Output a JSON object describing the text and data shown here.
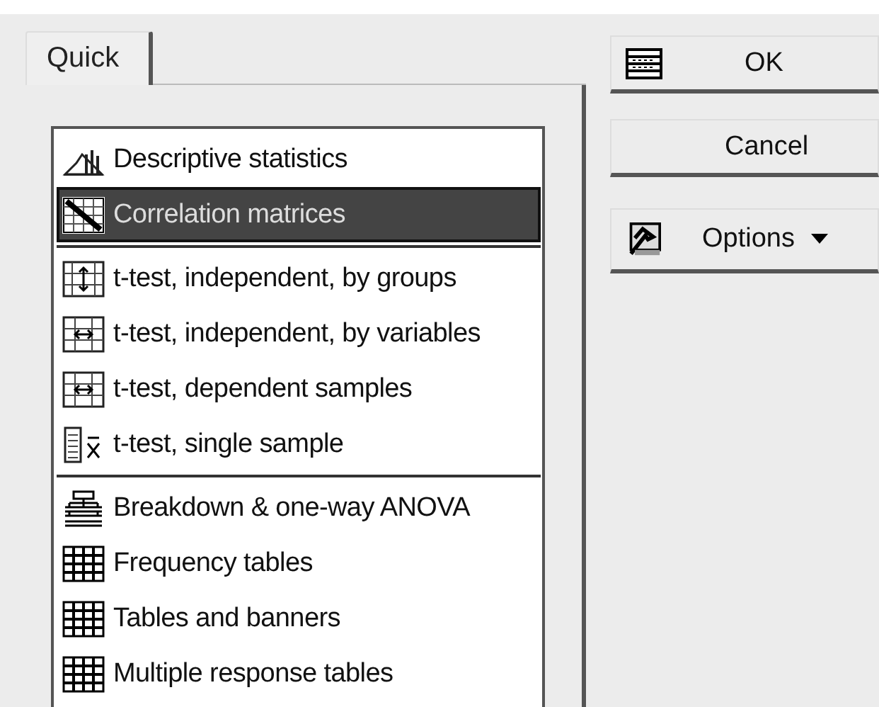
{
  "tabs": [
    {
      "label": "Quick",
      "selected": true
    }
  ],
  "list": {
    "groups": [
      {
        "items": [
          {
            "label": "Descriptive statistics",
            "kind": "histogram",
            "selected": false
          },
          {
            "label": "Correlation matrices",
            "kind": "matrix",
            "selected": true
          }
        ]
      },
      {
        "items": [
          {
            "label": "t-test, independent, by groups",
            "kind": "groups",
            "selected": false
          },
          {
            "label": "t-test, independent, by variables",
            "kind": "variables",
            "selected": false
          },
          {
            "label": "t-test, dependent samples",
            "kind": "variables",
            "selected": false
          },
          {
            "label": "t-test, single sample",
            "kind": "single",
            "selected": false
          }
        ]
      },
      {
        "items": [
          {
            "label": "Breakdown & one-way ANOVA",
            "kind": "tree",
            "selected": false
          },
          {
            "label": "Frequency tables",
            "kind": "grid",
            "selected": false
          },
          {
            "label": "Tables and banners",
            "kind": "grid",
            "selected": false
          },
          {
            "label": "Multiple response tables",
            "kind": "grid",
            "selected": false
          }
        ]
      }
    ]
  },
  "buttons": [
    {
      "label": "OK",
      "kind": "ok"
    },
    {
      "label": "Cancel",
      "kind": "plain"
    },
    {
      "label": "Options",
      "kind": "menu"
    }
  ]
}
